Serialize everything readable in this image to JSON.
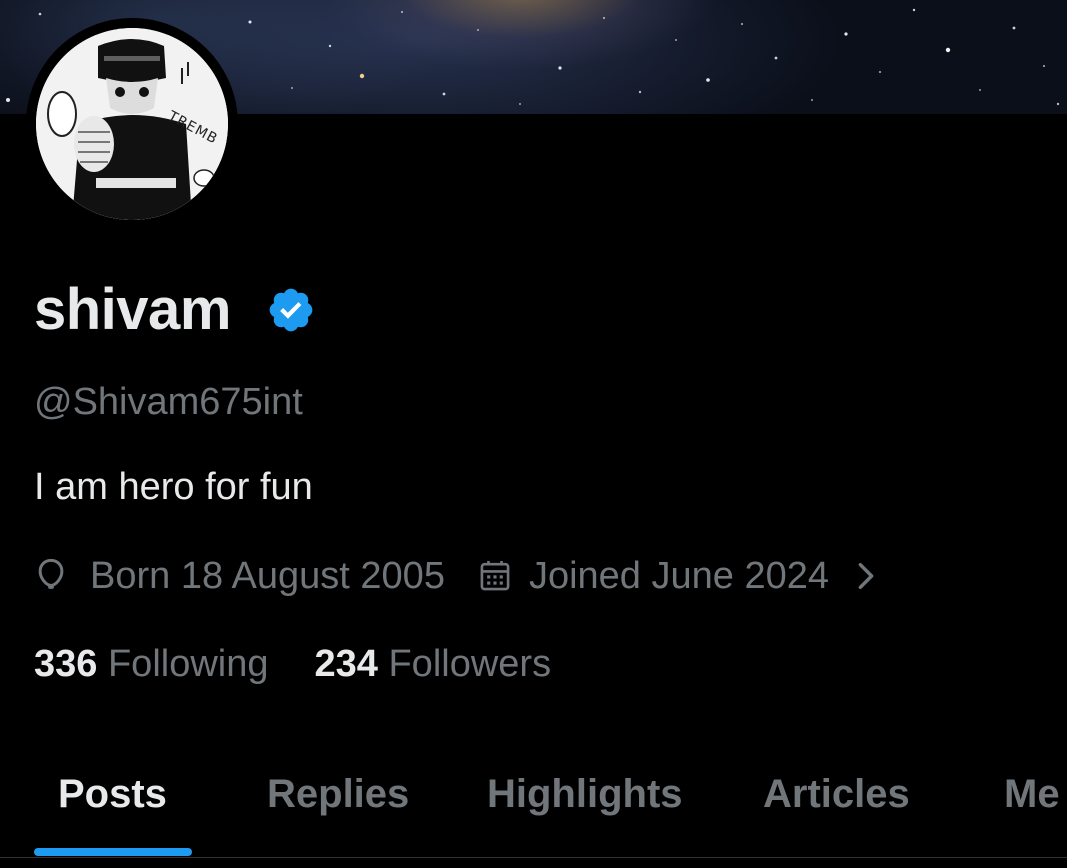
{
  "profile": {
    "display_name": "shivam",
    "handle": "@Shivam675int",
    "bio": "I am hero for fun",
    "verified_icon": "verified-badge-icon",
    "born_label": "Born 18 August 2005",
    "joined_label": "Joined June 2024",
    "following_count": "336",
    "following_label": "Following",
    "followers_count": "234",
    "followers_label": "Followers",
    "avatar_caption": "TREMB"
  },
  "tabs": [
    {
      "label": "Posts",
      "active": true
    },
    {
      "label": "Replies",
      "active": false
    },
    {
      "label": "Highlights",
      "active": false
    },
    {
      "label": "Articles",
      "active": false
    },
    {
      "label": "Me",
      "active": false
    }
  ],
  "colors": {
    "background": "#000000",
    "primary_text": "#e7e9ea",
    "secondary_text": "#71767b",
    "accent": "#1d9bf0"
  }
}
